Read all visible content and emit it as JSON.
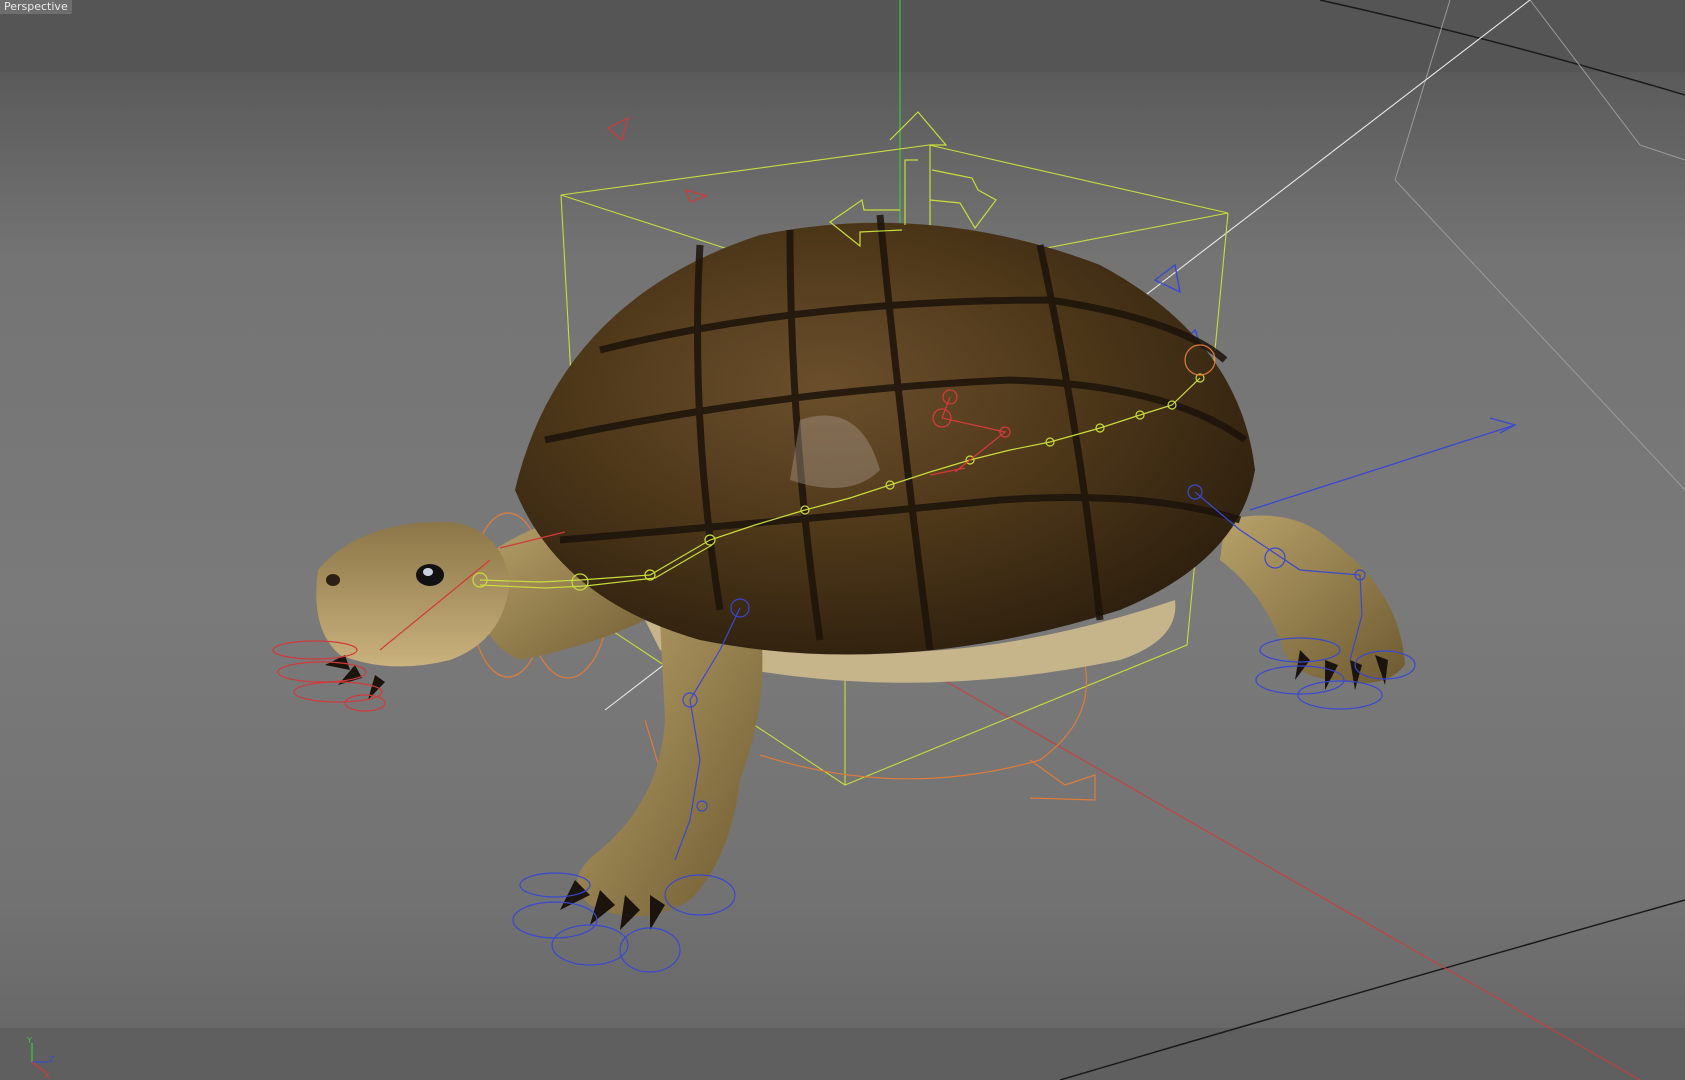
{
  "viewport": {
    "label": "Perspective",
    "background_top": "#525252",
    "background_mid": "#7a7a7a"
  },
  "scene": {
    "object": "turtle",
    "selection_box_color": "#c8dc3c",
    "rotation_handle_color": "#e07b39",
    "x_axis_color": "#d23a3a",
    "y_axis_color": "#3cc83c",
    "z_axis_color": "#3a48d2",
    "joint_chain_color": "#c8dc3c",
    "left_limb_controller_color": "#d23a3a",
    "right_limb_controller_color": "#3a48d2"
  },
  "axis_gizmo": {
    "y_label": "Y",
    "z_label": "Z",
    "x_label": "X"
  }
}
